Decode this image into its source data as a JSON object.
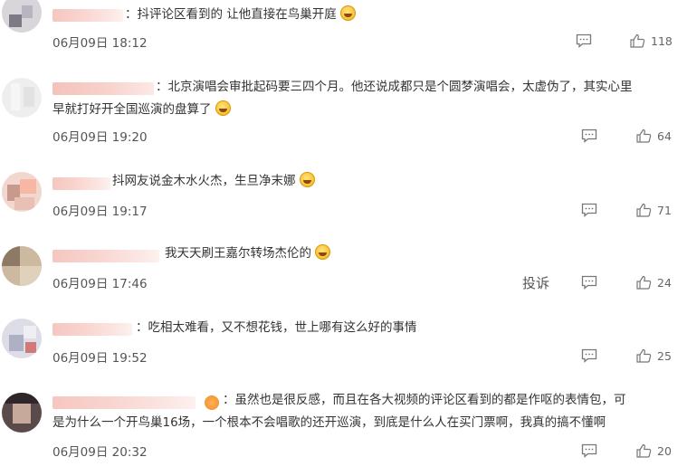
{
  "comments": [
    {
      "text": "：抖评论区看到的 让他直接在鸟巢开庭",
      "time": "06月09日 18:12",
      "likes": "118"
    },
    {
      "text_line1": "：北京演唱会审批起码要三四个月。他还说成都只是个圆梦演唱会，太虚伪了，其实心里",
      "text_line2": "早就打好开全国巡演的盘算了",
      "time": "06月09日 19:20",
      "likes": "64"
    },
    {
      "text": "抖网友说金木水火杰，生旦净末娜",
      "time": "06月09日 19:17",
      "likes": "71"
    },
    {
      "text": "我天天刷王嘉尔转场杰伦的",
      "time": "06月09日 17:46",
      "likes": "24",
      "report_label": "投诉"
    },
    {
      "text": "：吃相太难看，又不想花钱，世上哪有这么好的事情",
      "time": "06月09日 19:52",
      "likes": "25"
    },
    {
      "text_line1": "：虽然也是很反感，而且在各大视频的评论区看到的都是作呕的表情包，可",
      "text_line2": "是为什么一个开鸟巢16场，一个根本不会唱歌的还开巡演，到底是什么人在买门票啊，我真的搞不懂啊",
      "time": "06月09日 20:32",
      "likes": "20"
    }
  ],
  "icons": {
    "reply": "comment-icon",
    "like": "thumbs-up-icon",
    "emoji": "emoji-icon",
    "badge": "crown-badge-icon"
  },
  "colors": {
    "name_blur": "#f6c6c0",
    "text": "#333333",
    "meta": "#555555"
  }
}
